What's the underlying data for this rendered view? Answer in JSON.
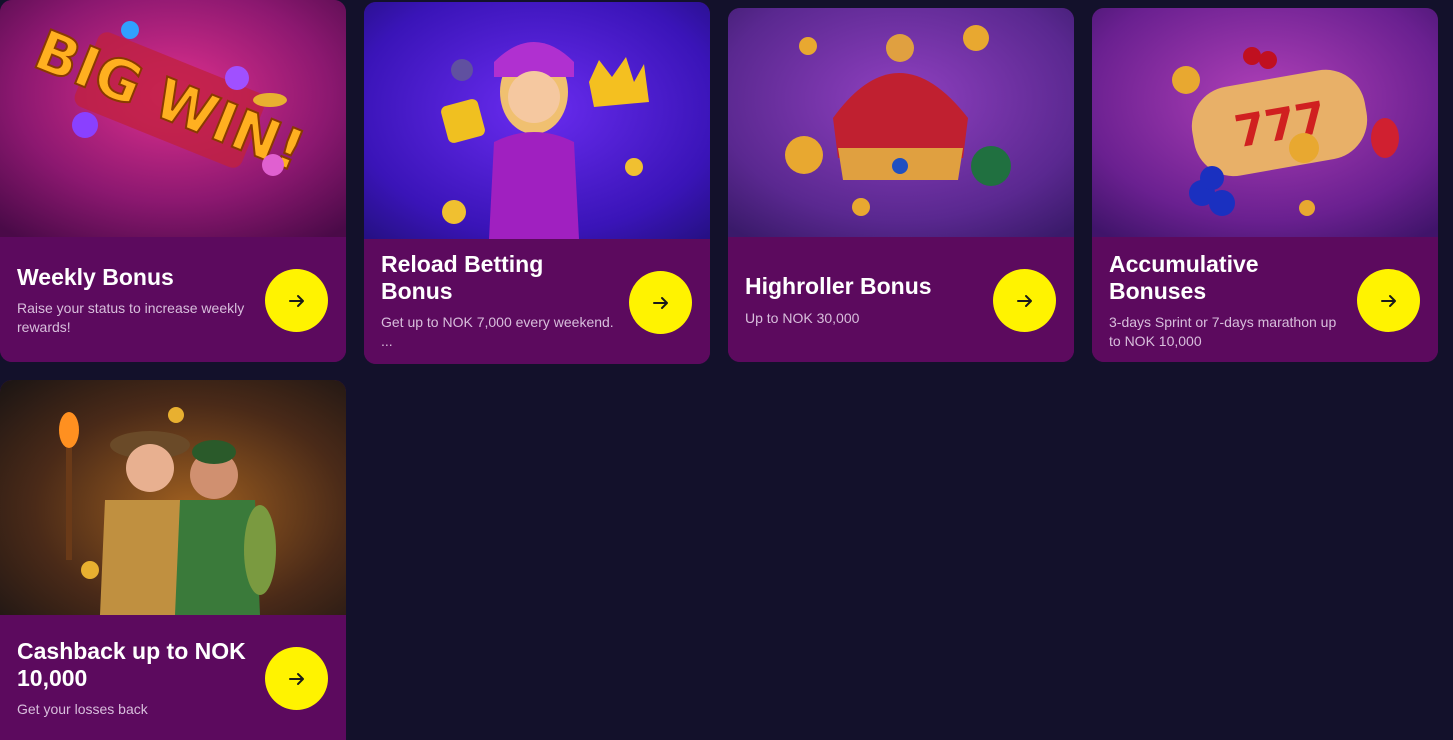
{
  "promotions": [
    {
      "title": "Weekly Bonus",
      "description": "Raise your status to increase weekly rewards!",
      "art_icon": "big-win-art",
      "button_icon": "arrow-right-icon"
    },
    {
      "title": "Reload Betting Bonus",
      "description": "Get up to NOK 7,000  every weekend. ...",
      "art_icon": "girl-with-crown-art",
      "button_icon": "arrow-right-icon"
    },
    {
      "title": "Highroller Bonus",
      "description": "Up to NOK 30,000",
      "art_icon": "red-crown-art",
      "button_icon": "arrow-right-icon"
    },
    {
      "title": "Accumulative Bonuses",
      "description": "3-days Sprint or 7-days marathon up to NOK 10,000",
      "art_icon": "slot-reel-777-art",
      "button_icon": "arrow-right-icon"
    },
    {
      "title": "Cashback up to NOK 10,000",
      "description": "Get your losses back",
      "art_icon": "explorers-cave-art",
      "button_icon": "arrow-right-icon"
    }
  ],
  "colors": {
    "page_background": "#13112b",
    "card_background": "#5c0a5e",
    "button_background": "#fff300",
    "title_text": "#ffffff",
    "description_text": "#d8bedc"
  }
}
